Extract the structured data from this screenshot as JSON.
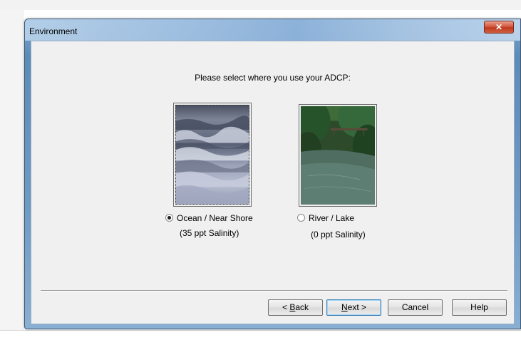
{
  "window": {
    "title": "Environment",
    "close_glyph": "✕"
  },
  "prompt": "Please select where you use your ADCP:",
  "options": [
    {
      "label": "Ocean / Near Shore",
      "sublabel": "(35 ppt Salinity)",
      "selected": true,
      "image": "ocean-waves-photo"
    },
    {
      "label": "River / Lake",
      "sublabel": "(0 ppt Salinity)",
      "selected": false,
      "image": "river-photo"
    }
  ],
  "buttons": {
    "back": {
      "prefix": "< ",
      "accel": "B",
      "rest": "ack"
    },
    "next": {
      "accel": "N",
      "rest": "ext >"
    },
    "cancel": "Cancel",
    "help": "Help"
  },
  "colors": {
    "client_bg": "#f0f0f0",
    "titlebar_blue": "#8fb3da",
    "close_red": "#c0391f"
  }
}
